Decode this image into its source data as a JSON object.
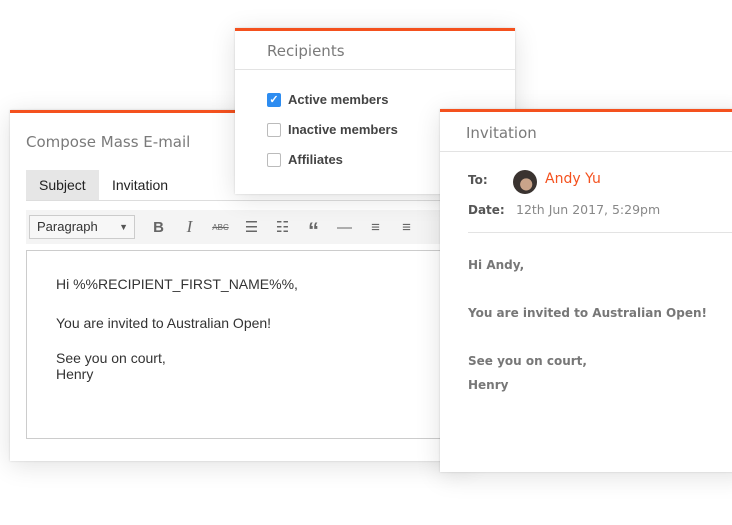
{
  "compose": {
    "title": "Compose Mass E-mail",
    "subject_label": "Subject",
    "subject_value": "Invitation",
    "toolbar": {
      "format": "Paragraph",
      "buttons": [
        "bold",
        "italic",
        "strikethrough",
        "bullet-list",
        "numbered-list",
        "blockquote",
        "horizontal-rule",
        "align-left",
        "align-center"
      ]
    },
    "body": [
      "Hi %%RECIPIENT_FIRST_NAME%%,",
      "You are invited to Australian Open!",
      "See you on court,",
      "Henry"
    ]
  },
  "recipients": {
    "title": "Recipients",
    "options": [
      {
        "label": "Active members",
        "checked": true
      },
      {
        "label": "Inactive members",
        "checked": false
      },
      {
        "label": "Affiliates",
        "checked": false
      }
    ]
  },
  "invitation": {
    "title": "Invitation",
    "to_label": "To:",
    "to_name": "Andy Yu",
    "date_label": "Date:",
    "date": "12th Jun 2017, 5:29pm",
    "body": [
      "Hi Andy,",
      "You are invited to Australian Open!",
      "See you on court,",
      "Henry"
    ]
  },
  "colors": {
    "accent": "#f4511e",
    "checkbox": "#2d8cf0"
  }
}
